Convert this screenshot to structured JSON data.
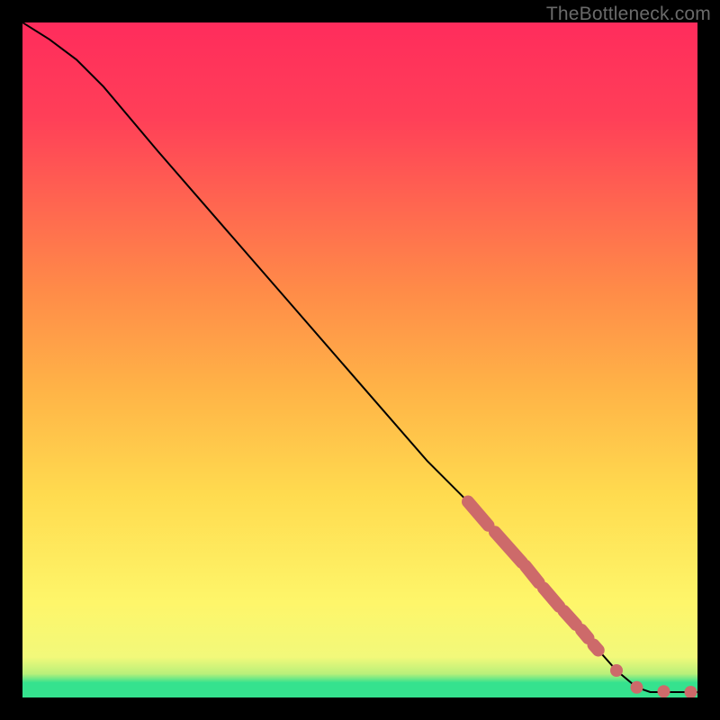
{
  "watermark": "TheBottleneck.com",
  "chart_data": {
    "type": "line",
    "title": "",
    "xlabel": "",
    "ylabel": "",
    "xlim": [
      0,
      100
    ],
    "ylim": [
      0,
      100
    ],
    "curve": [
      {
        "x": 0,
        "y": 100
      },
      {
        "x": 4,
        "y": 97.5
      },
      {
        "x": 8,
        "y": 94.5
      },
      {
        "x": 12,
        "y": 90.5
      },
      {
        "x": 20,
        "y": 81
      },
      {
        "x": 30,
        "y": 69.5
      },
      {
        "x": 40,
        "y": 58
      },
      {
        "x": 50,
        "y": 46.5
      },
      {
        "x": 60,
        "y": 35
      },
      {
        "x": 66,
        "y": 29
      },
      {
        "x": 70,
        "y": 24.5
      },
      {
        "x": 75,
        "y": 19
      },
      {
        "x": 80,
        "y": 13
      },
      {
        "x": 84,
        "y": 8.5
      },
      {
        "x": 88,
        "y": 4
      },
      {
        "x": 91,
        "y": 1.5
      },
      {
        "x": 93,
        "y": 0.8
      },
      {
        "x": 96,
        "y": 0.8
      },
      {
        "x": 100,
        "y": 0.8
      }
    ],
    "highlight_segments": [
      {
        "x1": 66,
        "y1": 29,
        "x2": 69,
        "y2": 25.5
      },
      {
        "x1": 70,
        "y1": 24.5,
        "x2": 74,
        "y2": 20
      },
      {
        "x1": 74.5,
        "y1": 19.5,
        "x2": 76.5,
        "y2": 17
      },
      {
        "x1": 77.2,
        "y1": 16.2,
        "x2": 79.5,
        "y2": 13.5
      },
      {
        "x1": 80.2,
        "y1": 12.8,
        "x2": 82,
        "y2": 10.8
      },
      {
        "x1": 82.8,
        "y1": 10,
        "x2": 83.8,
        "y2": 8.8
      },
      {
        "x1": 84.6,
        "y1": 7.8,
        "x2": 85.3,
        "y2": 7
      }
    ],
    "highlight_dots": [
      {
        "x": 88,
        "y": 4
      },
      {
        "x": 91,
        "y": 1.5
      },
      {
        "x": 95,
        "y": 0.9
      },
      {
        "x": 99,
        "y": 0.8
      }
    ]
  }
}
